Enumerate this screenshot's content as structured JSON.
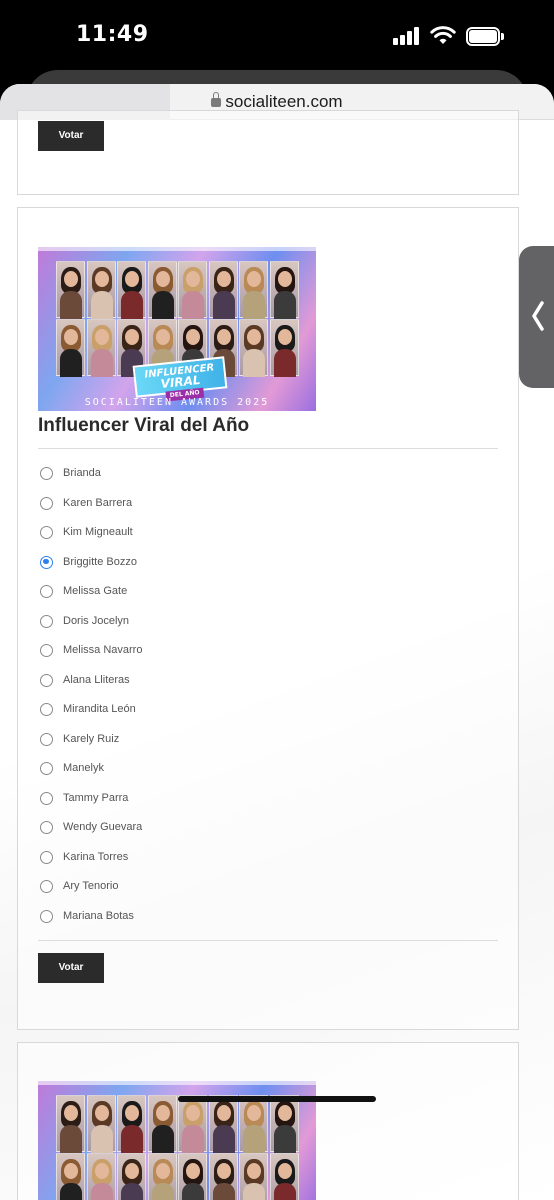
{
  "status_bar": {
    "time": "11:49"
  },
  "browser": {
    "domain": "socialiteen.com"
  },
  "prev_card": {
    "vote_label": "Votar"
  },
  "category": {
    "banner_badge_line1": "INFLUENCER",
    "banner_badge_line2": "VIRAL",
    "banner_badge_sub": "DEL AÑO",
    "banner_caption": "SOCIALITEEN AWARDS 2025",
    "title": "Influencer Viral del Año",
    "selected_index": 3,
    "options": [
      "Brianda",
      "Karen Barrera",
      "Kim Migneault",
      "Briggitte Bozzo",
      "Melissa Gate",
      "Doris Jocelyn",
      "Melissa Navarro",
      "Alana Lliteras",
      "Mirandita León",
      "Karely Ruiz",
      "Manelyk",
      "Tammy Parra",
      "Wendy Guevara",
      "Karina Torres",
      "Ary Tenorio",
      "Mariana Botas"
    ],
    "vote_label": "Votar"
  },
  "colors": {
    "accent": "#2f80ed",
    "button": "#2b2b2b"
  }
}
